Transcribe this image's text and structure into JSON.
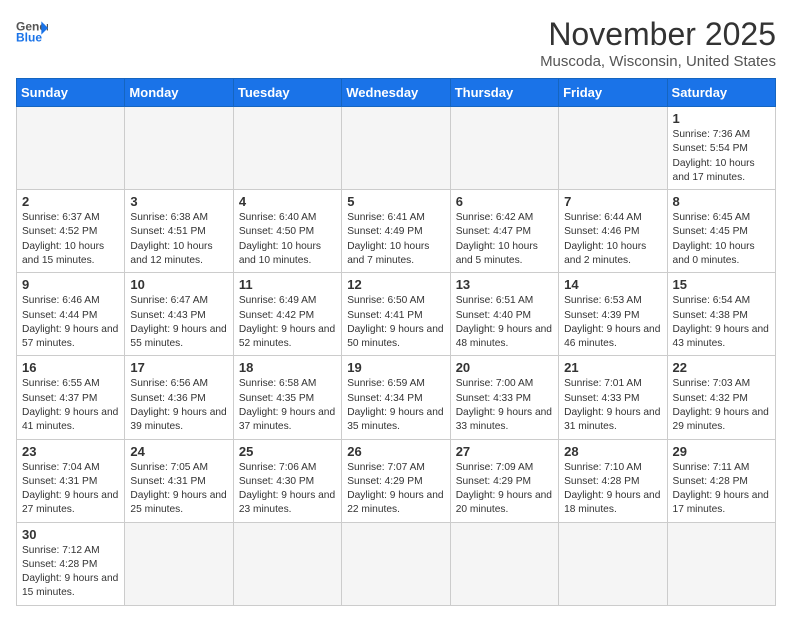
{
  "header": {
    "logo_general": "General",
    "logo_blue": "Blue",
    "month": "November 2025",
    "location": "Muscoda, Wisconsin, United States"
  },
  "days_of_week": [
    "Sunday",
    "Monday",
    "Tuesday",
    "Wednesday",
    "Thursday",
    "Friday",
    "Saturday"
  ],
  "weeks": [
    [
      {
        "day": "",
        "empty": true
      },
      {
        "day": "",
        "empty": true
      },
      {
        "day": "",
        "empty": true
      },
      {
        "day": "",
        "empty": true
      },
      {
        "day": "",
        "empty": true
      },
      {
        "day": "",
        "empty": true
      },
      {
        "day": "1",
        "info": "Sunrise: 7:36 AM\nSunset: 5:54 PM\nDaylight: 10 hours\nand 17 minutes."
      }
    ],
    [
      {
        "day": "2",
        "info": "Sunrise: 6:37 AM\nSunset: 4:52 PM\nDaylight: 10 hours\nand 15 minutes."
      },
      {
        "day": "3",
        "info": "Sunrise: 6:38 AM\nSunset: 4:51 PM\nDaylight: 10 hours\nand 12 minutes."
      },
      {
        "day": "4",
        "info": "Sunrise: 6:40 AM\nSunset: 4:50 PM\nDaylight: 10 hours\nand 10 minutes."
      },
      {
        "day": "5",
        "info": "Sunrise: 6:41 AM\nSunset: 4:49 PM\nDaylight: 10 hours\nand 7 minutes."
      },
      {
        "day": "6",
        "info": "Sunrise: 6:42 AM\nSunset: 4:47 PM\nDaylight: 10 hours\nand 5 minutes."
      },
      {
        "day": "7",
        "info": "Sunrise: 6:44 AM\nSunset: 4:46 PM\nDaylight: 10 hours\nand 2 minutes."
      },
      {
        "day": "8",
        "info": "Sunrise: 6:45 AM\nSunset: 4:45 PM\nDaylight: 10 hours\nand 0 minutes."
      }
    ],
    [
      {
        "day": "9",
        "info": "Sunrise: 6:46 AM\nSunset: 4:44 PM\nDaylight: 9 hours\nand 57 minutes."
      },
      {
        "day": "10",
        "info": "Sunrise: 6:47 AM\nSunset: 4:43 PM\nDaylight: 9 hours\nand 55 minutes."
      },
      {
        "day": "11",
        "info": "Sunrise: 6:49 AM\nSunset: 4:42 PM\nDaylight: 9 hours\nand 52 minutes."
      },
      {
        "day": "12",
        "info": "Sunrise: 6:50 AM\nSunset: 4:41 PM\nDaylight: 9 hours\nand 50 minutes."
      },
      {
        "day": "13",
        "info": "Sunrise: 6:51 AM\nSunset: 4:40 PM\nDaylight: 9 hours\nand 48 minutes."
      },
      {
        "day": "14",
        "info": "Sunrise: 6:53 AM\nSunset: 4:39 PM\nDaylight: 9 hours\nand 46 minutes."
      },
      {
        "day": "15",
        "info": "Sunrise: 6:54 AM\nSunset: 4:38 PM\nDaylight: 9 hours\nand 43 minutes."
      }
    ],
    [
      {
        "day": "16",
        "info": "Sunrise: 6:55 AM\nSunset: 4:37 PM\nDaylight: 9 hours\nand 41 minutes."
      },
      {
        "day": "17",
        "info": "Sunrise: 6:56 AM\nSunset: 4:36 PM\nDaylight: 9 hours\nand 39 minutes."
      },
      {
        "day": "18",
        "info": "Sunrise: 6:58 AM\nSunset: 4:35 PM\nDaylight: 9 hours\nand 37 minutes."
      },
      {
        "day": "19",
        "info": "Sunrise: 6:59 AM\nSunset: 4:34 PM\nDaylight: 9 hours\nand 35 minutes."
      },
      {
        "day": "20",
        "info": "Sunrise: 7:00 AM\nSunset: 4:33 PM\nDaylight: 9 hours\nand 33 minutes."
      },
      {
        "day": "21",
        "info": "Sunrise: 7:01 AM\nSunset: 4:33 PM\nDaylight: 9 hours\nand 31 minutes."
      },
      {
        "day": "22",
        "info": "Sunrise: 7:03 AM\nSunset: 4:32 PM\nDaylight: 9 hours\nand 29 minutes."
      }
    ],
    [
      {
        "day": "23",
        "info": "Sunrise: 7:04 AM\nSunset: 4:31 PM\nDaylight: 9 hours\nand 27 minutes."
      },
      {
        "day": "24",
        "info": "Sunrise: 7:05 AM\nSunset: 4:31 PM\nDaylight: 9 hours\nand 25 minutes."
      },
      {
        "day": "25",
        "info": "Sunrise: 7:06 AM\nSunset: 4:30 PM\nDaylight: 9 hours\nand 23 minutes."
      },
      {
        "day": "26",
        "info": "Sunrise: 7:07 AM\nSunset: 4:29 PM\nDaylight: 9 hours\nand 22 minutes."
      },
      {
        "day": "27",
        "info": "Sunrise: 7:09 AM\nSunset: 4:29 PM\nDaylight: 9 hours\nand 20 minutes."
      },
      {
        "day": "28",
        "info": "Sunrise: 7:10 AM\nSunset: 4:28 PM\nDaylight: 9 hours\nand 18 minutes."
      },
      {
        "day": "29",
        "info": "Sunrise: 7:11 AM\nSunset: 4:28 PM\nDaylight: 9 hours\nand 17 minutes."
      }
    ],
    [
      {
        "day": "30",
        "info": "Sunrise: 7:12 AM\nSunset: 4:28 PM\nDaylight: 9 hours\nand 15 minutes."
      },
      {
        "day": "",
        "empty": true
      },
      {
        "day": "",
        "empty": true
      },
      {
        "day": "",
        "empty": true
      },
      {
        "day": "",
        "empty": true
      },
      {
        "day": "",
        "empty": true
      },
      {
        "day": "",
        "empty": true
      }
    ]
  ]
}
